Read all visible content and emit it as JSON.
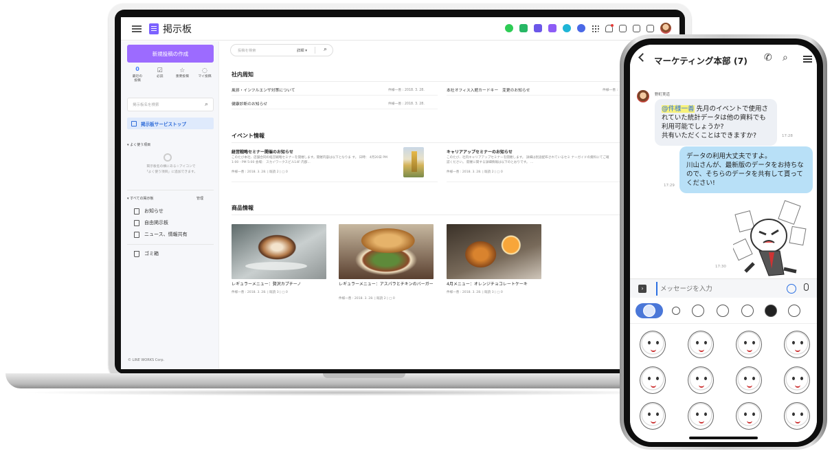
{
  "laptop": {
    "app_title": "掲示板",
    "sidebar": {
      "new_post": "新規投稿の作成",
      "quick": [
        {
          "count": "0",
          "label": "最近の\n投稿"
        },
        {
          "icon": "check-square-icon",
          "label": "必読"
        },
        {
          "icon": "star-icon",
          "label": "重要投稿"
        },
        {
          "icon": "chat-bubble-icon",
          "label": "マイ投稿"
        }
      ],
      "search_placeholder": "掲示板名を検索",
      "service_top": "掲示板サービストップ",
      "favorites_label": "よく使う項目",
      "favorites_hint": "掲示板名の横にある☆アイコンで\n「よく使う項目」に追加できます。",
      "all_boards_label": "すべての掲示板",
      "manage": "管理",
      "boards": [
        "お知らせ",
        "自由掲示板",
        "ニュース、情報共有"
      ],
      "trash": "ゴミ箱",
      "footer": "© LINE WORKS Corp."
    },
    "main": {
      "search_placeholder": "投稿を検索",
      "search_detail": "詳細 ▾",
      "notices_title": "社内周知",
      "notices": [
        {
          "title": "風邪・インフルエンザ対策について",
          "meta": "件様一善 : 2018. 3. 28."
        },
        {
          "title": "本社オフィス入館カードキー　変更のお知らせ",
          "meta": "件様一善 :"
        },
        {
          "title": "健康診断のお知らせ",
          "meta": "件様一善 : 2018. 3. 28."
        }
      ],
      "events_title": "イベント情報",
      "events": [
        {
          "title": "経営戦略セミナー開催のお知らせ",
          "body": "このたび本社、店舗合同の経営戦略セミナーを開催します。開催内容は以下となりま す。 日時： 4月20日 PM 1:00 - PM 5:00 会場： スカイワークスビル14F 内部...",
          "meta": "件様一善 : 2018. 3. 28. | 既読 2 | ▢ 0"
        },
        {
          "title": "キャリアアップセミナーのお知らせ",
          "body": "このたび、社内キャリアアップセミナーを開催します。 詳細は別途配布されているセミ ナーガイドの資料にてご確認ください。 開催に関する詳細情報は以下のとおりです。 ...",
          "meta": "件様一善 : 2018. 3. 28. | 既読 2 | ▢ 0"
        }
      ],
      "products_title": "商品情報",
      "products": [
        {
          "title": "レギュラーメニュー：贅沢カプチーノ",
          "meta": "件様一善 : 2018. 3. 28. | 既読 3 | ▢ 0"
        },
        {
          "title": "レギュラーメニュー：アスパラとチキンのバーガー",
          "meta": "件様一善 : 2018. 3. 28. | 既読 2 | ▢ 0"
        },
        {
          "title": "4月メニュー：オレンジチョコレートケーキ",
          "meta": "件様一善 : 2018. 3. 28. | 既読 3 | ▢ 0"
        }
      ]
    }
  },
  "phone": {
    "chat_title": "マーケティング本部 (7)",
    "sender": "野町実道",
    "incoming": {
      "mention": "@件様一善",
      "text": " 先月のイベントで使用されていた統計データは他の資料でも利用可能でしょうか?\n共有いただくことはできますか?",
      "time": "17:28"
    },
    "outgoing": {
      "text": "データの利用大丈夫ですよ。\n川山さんが、最新版のデータをお持ちなので、そちらのデータを共有して貰ってください!",
      "time": "17:29"
    },
    "sticker_time": "17:30",
    "input_placeholder": "メッセージを入力"
  }
}
